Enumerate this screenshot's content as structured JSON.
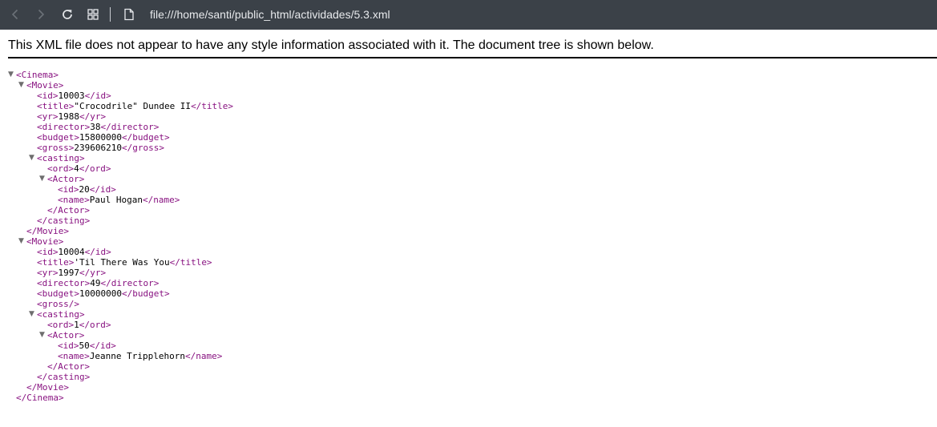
{
  "browser": {
    "url": "file:///home/santi/public_html/actividades/5.3.xml",
    "icons": {
      "back": "arrow-left-icon",
      "forward": "arrow-right-icon",
      "reload": "reload-icon",
      "tabs": "grid-icon",
      "page": "document-icon"
    }
  },
  "notice": "This XML file does not appear to have any style information associated with it. The document tree is shown below.",
  "colors": {
    "toolbar": "#3b4148",
    "tag": "#881280",
    "text": "#000000"
  },
  "xml_tree": [
    {
      "indent": 0,
      "toggle": true,
      "open": "<Cinema>",
      "text": "",
      "close": ""
    },
    {
      "indent": 1,
      "toggle": true,
      "open": "<Movie>",
      "text": "",
      "close": ""
    },
    {
      "indent": 2,
      "toggle": false,
      "open": "<id>",
      "text": "10003",
      "close": "</id>"
    },
    {
      "indent": 2,
      "toggle": false,
      "open": "<title>",
      "text": "\"Crocodrile\" Dundee II",
      "close": "</title>"
    },
    {
      "indent": 2,
      "toggle": false,
      "open": "<yr>",
      "text": "1988",
      "close": "</yr>"
    },
    {
      "indent": 2,
      "toggle": false,
      "open": "<director>",
      "text": "38",
      "close": "</director>"
    },
    {
      "indent": 2,
      "toggle": false,
      "open": "<budget>",
      "text": "15800000",
      "close": "</budget>"
    },
    {
      "indent": 2,
      "toggle": false,
      "open": "<gross>",
      "text": "239606210",
      "close": "</gross>"
    },
    {
      "indent": 2,
      "toggle": true,
      "open": "<casting>",
      "text": "",
      "close": ""
    },
    {
      "indent": 3,
      "toggle": false,
      "open": "<ord>",
      "text": "4",
      "close": "</ord>"
    },
    {
      "indent": 3,
      "toggle": true,
      "open": "<Actor>",
      "text": "",
      "close": ""
    },
    {
      "indent": 4,
      "toggle": false,
      "open": "<id>",
      "text": "20",
      "close": "</id>"
    },
    {
      "indent": 4,
      "toggle": false,
      "open": "<name>",
      "text": "Paul Hogan",
      "close": "</name>"
    },
    {
      "indent": 3,
      "toggle": false,
      "open": "",
      "text": "",
      "close": "</Actor>"
    },
    {
      "indent": 2,
      "toggle": false,
      "open": "",
      "text": "",
      "close": "</casting>"
    },
    {
      "indent": 1,
      "toggle": false,
      "open": "",
      "text": "",
      "close": "</Movie>"
    },
    {
      "indent": 1,
      "toggle": true,
      "open": "<Movie>",
      "text": "",
      "close": ""
    },
    {
      "indent": 2,
      "toggle": false,
      "open": "<id>",
      "text": "10004",
      "close": "</id>"
    },
    {
      "indent": 2,
      "toggle": false,
      "open": "<title>",
      "text": "'Til There Was You",
      "close": "</title>"
    },
    {
      "indent": 2,
      "toggle": false,
      "open": "<yr>",
      "text": "1997",
      "close": "</yr>"
    },
    {
      "indent": 2,
      "toggle": false,
      "open": "<director>",
      "text": "49",
      "close": "</director>"
    },
    {
      "indent": 2,
      "toggle": false,
      "open": "<budget>",
      "text": "10000000",
      "close": "</budget>"
    },
    {
      "indent": 2,
      "toggle": false,
      "open": "<gross/>",
      "text": "",
      "close": ""
    },
    {
      "indent": 2,
      "toggle": true,
      "open": "<casting>",
      "text": "",
      "close": ""
    },
    {
      "indent": 3,
      "toggle": false,
      "open": "<ord>",
      "text": "1",
      "close": "</ord>"
    },
    {
      "indent": 3,
      "toggle": true,
      "open": "<Actor>",
      "text": "",
      "close": ""
    },
    {
      "indent": 4,
      "toggle": false,
      "open": "<id>",
      "text": "50",
      "close": "</id>"
    },
    {
      "indent": 4,
      "toggle": false,
      "open": "<name>",
      "text": "Jeanne Tripplehorn",
      "close": "</name>"
    },
    {
      "indent": 3,
      "toggle": false,
      "open": "",
      "text": "",
      "close": "</Actor>"
    },
    {
      "indent": 2,
      "toggle": false,
      "open": "",
      "text": "",
      "close": "</casting>"
    },
    {
      "indent": 1,
      "toggle": false,
      "open": "",
      "text": "",
      "close": "</Movie>"
    },
    {
      "indent": 0,
      "toggle": false,
      "open": "",
      "text": "",
      "close": "</Cinema>"
    }
  ]
}
